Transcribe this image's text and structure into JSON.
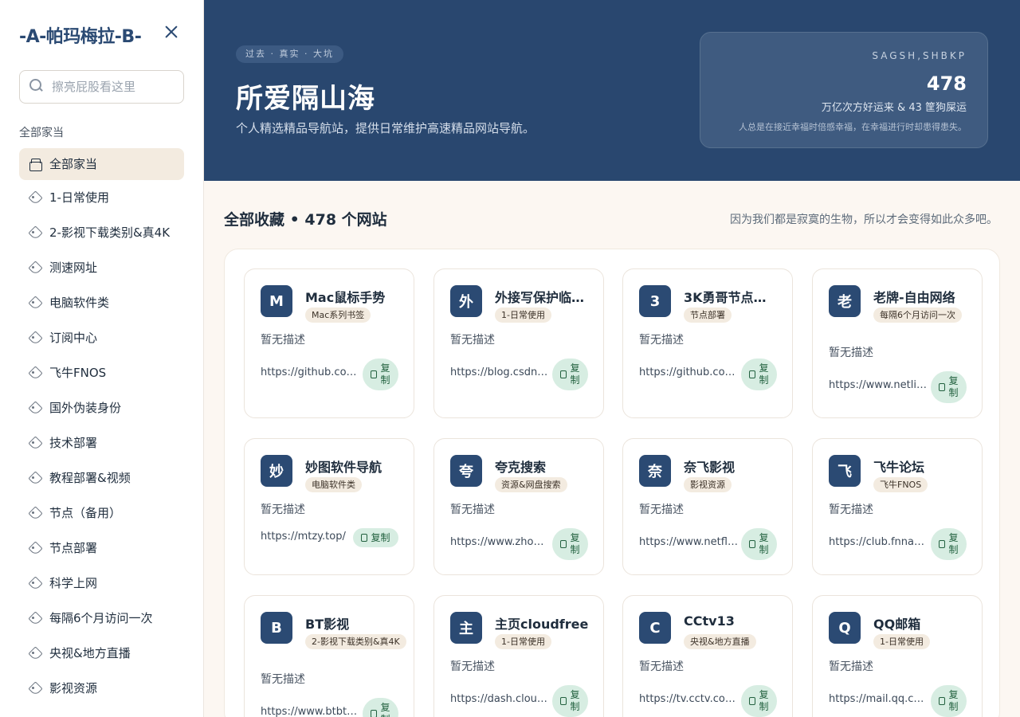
{
  "sidebar": {
    "brand": "-A-帕玛梅拉-B-",
    "search_placeholder": "擦亮屁股看这里",
    "section_label": "全部家当",
    "items": [
      {
        "label": "全部家当",
        "active": true,
        "icon": "all-icon"
      },
      {
        "label": "1-日常使用",
        "icon": "tag-icon"
      },
      {
        "label": "2-影视下载类别&真4K",
        "icon": "tag-icon"
      },
      {
        "label": "测速网址",
        "icon": "tag-icon"
      },
      {
        "label": "电脑软件类",
        "icon": "tag-icon"
      },
      {
        "label": "订阅中心",
        "icon": "tag-icon"
      },
      {
        "label": "飞牛FNOS",
        "icon": "tag-icon"
      },
      {
        "label": "国外伪装身份",
        "icon": "tag-icon"
      },
      {
        "label": "技术部署",
        "icon": "tag-icon"
      },
      {
        "label": "教程部署&视频",
        "icon": "tag-icon"
      },
      {
        "label": "节点（备用）",
        "icon": "tag-icon"
      },
      {
        "label": "节点部署",
        "icon": "tag-icon"
      },
      {
        "label": "科学上网",
        "icon": "tag-icon"
      },
      {
        "label": "每隔6个月访问一次",
        "icon": "tag-icon"
      },
      {
        "label": "央视&地方直播",
        "icon": "tag-icon"
      },
      {
        "label": "影视资源",
        "icon": "tag-icon"
      }
    ]
  },
  "hero": {
    "tagline": "过去 · 真实 · 大坑",
    "title": "所爱隔山海",
    "subtitle": "个人精选精品导航站，提供日常维护高速精品网站导航。",
    "stats": {
      "code": "SAGSH,SHBKP",
      "count": "478",
      "line": "万亿次方好运来 & 43 筐狗屎运",
      "note": "人总是在接近幸福时倍感幸福，在幸福进行时却患得患失。"
    }
  },
  "main": {
    "title": "全部收藏 • 478 个网站",
    "quote": "因为我们都是寂寞的生物，所以才会变得如此众多吧。"
  },
  "copy_label": "复制",
  "cards": [
    {
      "initial": "M",
      "title": "Mac鼠标手势",
      "category": "Mac系列书签",
      "desc": "暂无描述",
      "url": "https://github.com/…"
    },
    {
      "initial": "外",
      "title": "外接写保护临…",
      "category": "1-日常使用",
      "desc": "暂无描述",
      "url": "https://blog.csdn.ne…"
    },
    {
      "initial": "3",
      "title": "3K勇哥节点…",
      "category": "节点部署",
      "desc": "暂无描述",
      "url": "https://github.com/…"
    },
    {
      "initial": "老",
      "title": "老牌-自由网络",
      "category": "每隔6个月访问一次",
      "desc": "暂无描述",
      "url": "https://www.netlib…"
    },
    {
      "initial": "妙",
      "title": "妙图软件导航",
      "category": "电脑软件类",
      "desc": "暂无描述",
      "url": "https://mtzy.top/"
    },
    {
      "initial": "夸",
      "title": "夸克搜索",
      "category": "资源&网盘搜索",
      "desc": "暂无描述",
      "url": "https://www.zhongc…"
    },
    {
      "initial": "奈",
      "title": "奈飞影视",
      "category": "影视资源",
      "desc": "暂无描述",
      "url": "https://www.netflix…"
    },
    {
      "initial": "飞",
      "title": "飞牛论坛",
      "category": "飞牛FNOS",
      "desc": "暂无描述",
      "url": "https://club.fnnas.c…"
    },
    {
      "initial": "B",
      "title": "BT影视",
      "category": "2-影视下载类别&真4K",
      "desc": "暂无描述",
      "url": "https://www.btbtla…"
    },
    {
      "initial": "主",
      "title": "主页cloudfree",
      "category": "1-日常使用",
      "desc": "暂无描述",
      "url": "https://dash.cloudfl…"
    },
    {
      "initial": "C",
      "title": "CCtv13",
      "category": "央视&地方直播",
      "desc": "暂无描述",
      "url": "https://tv.cctv.com/l…"
    },
    {
      "initial": "Q",
      "title": "QQ邮箱",
      "category": "1-日常使用",
      "desc": "暂无描述",
      "url": "https://mail.qq.com…"
    }
  ]
}
